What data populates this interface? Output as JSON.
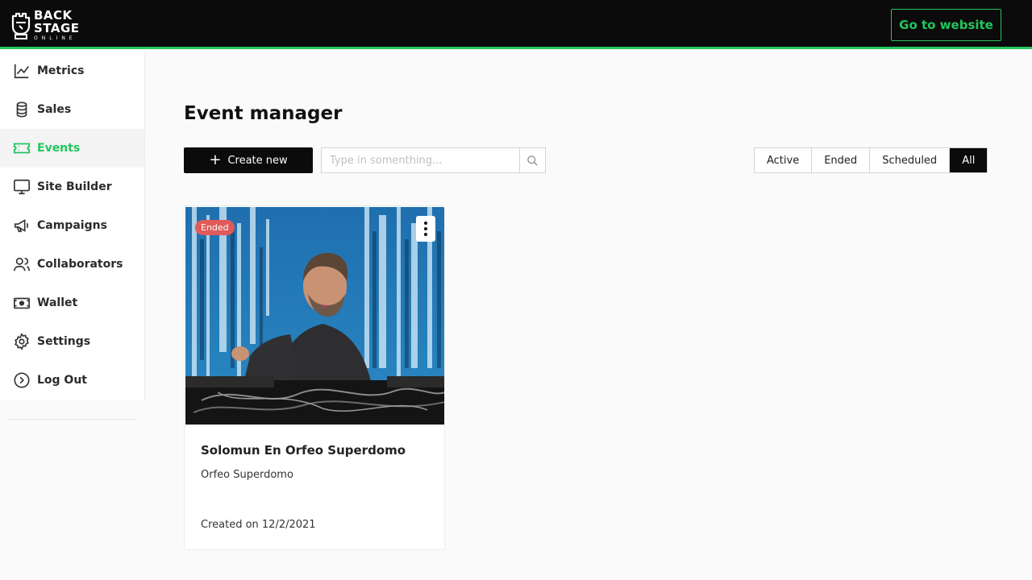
{
  "brand": {
    "logo_line1": "BACK",
    "logo_line2": "STAGE",
    "logo_line3": "ONLINE",
    "accent_color": "#22c55e"
  },
  "header": {
    "go_to_website_label": "Go to website"
  },
  "sidebar": {
    "items": [
      {
        "label": "Metrics",
        "icon": "chart-line-icon",
        "active": false
      },
      {
        "label": "Sales",
        "icon": "database-icon",
        "active": false
      },
      {
        "label": "Events",
        "icon": "ticket-icon",
        "active": true
      },
      {
        "label": "Site Builder",
        "icon": "monitor-icon",
        "active": false
      },
      {
        "label": "Campaigns",
        "icon": "megaphone-icon",
        "active": false
      },
      {
        "label": "Collaborators",
        "icon": "users-icon",
        "active": false
      },
      {
        "label": "Wallet",
        "icon": "money-icon",
        "active": false
      },
      {
        "label": "Settings",
        "icon": "gear-icon",
        "active": false
      },
      {
        "label": "Log Out",
        "icon": "logout-circle-icon",
        "active": false
      }
    ]
  },
  "main": {
    "title": "Event manager",
    "create_label": "Create new",
    "search": {
      "placeholder": "Type in somenthing...",
      "value": ""
    },
    "filters": [
      {
        "label": "Active",
        "active": false
      },
      {
        "label": "Ended",
        "active": false
      },
      {
        "label": "Scheduled",
        "active": false
      },
      {
        "label": "All",
        "active": true
      }
    ]
  },
  "events": [
    {
      "status": "Ended",
      "title": "Solomun En Orfeo Superdomo",
      "venue": "Orfeo Superdomo",
      "created": "Created on 12/2/2021",
      "status_color": "#e05a5a"
    }
  ]
}
